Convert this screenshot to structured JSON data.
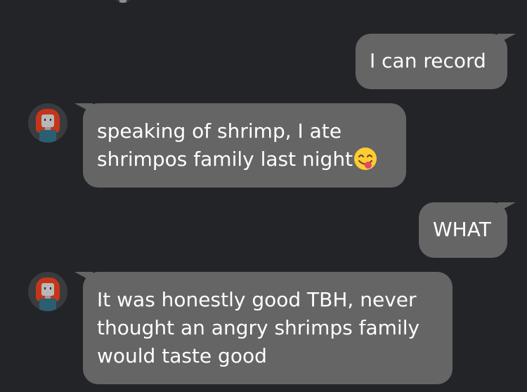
{
  "messages": [
    {
      "side": "out",
      "text": "I can record"
    },
    {
      "side": "in",
      "text": "speaking of shrimp, I ate\nshrimpos family last night",
      "emoji": "face-savoring-food-emoji"
    },
    {
      "side": "out",
      "text": "WHAT"
    },
    {
      "side": "in",
      "text": "It was honestly good TBH, never\nthought an angry shrimps family\nwould taste good"
    }
  ],
  "colors": {
    "background": "#232427",
    "bubble": "#656565",
    "text": "#ffffff"
  }
}
